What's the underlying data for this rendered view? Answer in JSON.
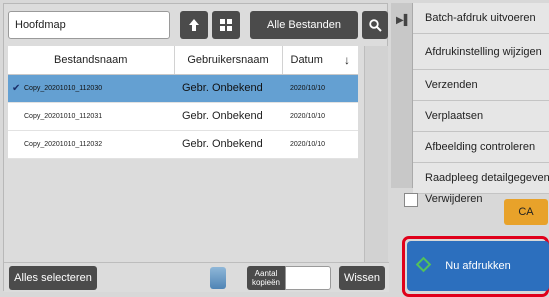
{
  "toolbar": {
    "folder": "Hoofdmap",
    "all_files": "Alle Bestanden"
  },
  "table": {
    "headers": [
      "Bestandsnaam",
      "Gebruikersnaam",
      "Datum"
    ],
    "rows": [
      {
        "name": "Copy_20201010_112030",
        "user": "Gebr. Onbekend",
        "date": "2020/10/10",
        "selected": true
      },
      {
        "name": "Copy_20201010_112031",
        "user": "Gebr. Onbekend",
        "date": "2020/10/10",
        "selected": false
      },
      {
        "name": "Copy_20201010_112032",
        "user": "Gebr. Onbekend",
        "date": "2020/10/10",
        "selected": false
      }
    ]
  },
  "bottom": {
    "select_all": "Alles selecteren",
    "copies_line1": "Aantal",
    "copies_line2": "kopieën",
    "copies_value": "",
    "clear": "Wissen"
  },
  "actions": [
    "Batch-afdruk uitvoeren",
    "Afdrukinstelling wijzigen",
    "Verzenden",
    "Verplaatsen",
    "Afbeelding controleren",
    "Raadpleeg detailgegevens"
  ],
  "delete_label": "Verwijderen",
  "ca_label": "CA",
  "print_label": "Nu afdrukken",
  "colors": {
    "selected_row": "#64a0d2",
    "dark_button": "#4b4b4b",
    "ca_button": "#e8a22a",
    "print_button": "#2c6fbe",
    "highlight": "#e0001a"
  }
}
